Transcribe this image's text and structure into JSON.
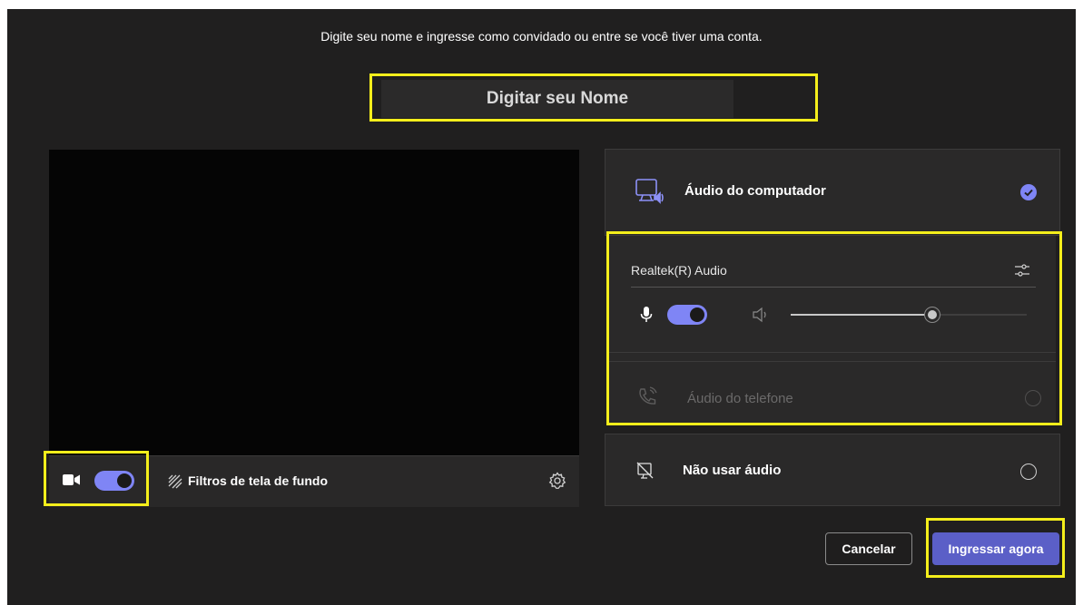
{
  "prompt": "Digite seu nome e ingresse como convidado ou entre se você tiver uma conta.",
  "name_input": {
    "placeholder": "Digitar seu Nome",
    "value": ""
  },
  "video": {
    "camera_on": true,
    "background_filters_label": "Filtros de tela de fundo"
  },
  "audio": {
    "computer_audio": {
      "label": "Áudio do computador",
      "selected": true
    },
    "device": {
      "name": "Realtek(R) Audio",
      "mic_on": true,
      "volume_level": 0.6
    },
    "phone_audio": {
      "label": "Áudio do telefone",
      "selected": false
    },
    "no_audio": {
      "label": "Não usar áudio",
      "selected": false
    }
  },
  "buttons": {
    "cancel_label": "Cancelar",
    "join_label": "Ingressar agora"
  },
  "colors": {
    "accent": "#7f85f5",
    "primary_button": "#5b5fc7",
    "highlight": "#f4ee1b",
    "background": "#201f1f"
  }
}
